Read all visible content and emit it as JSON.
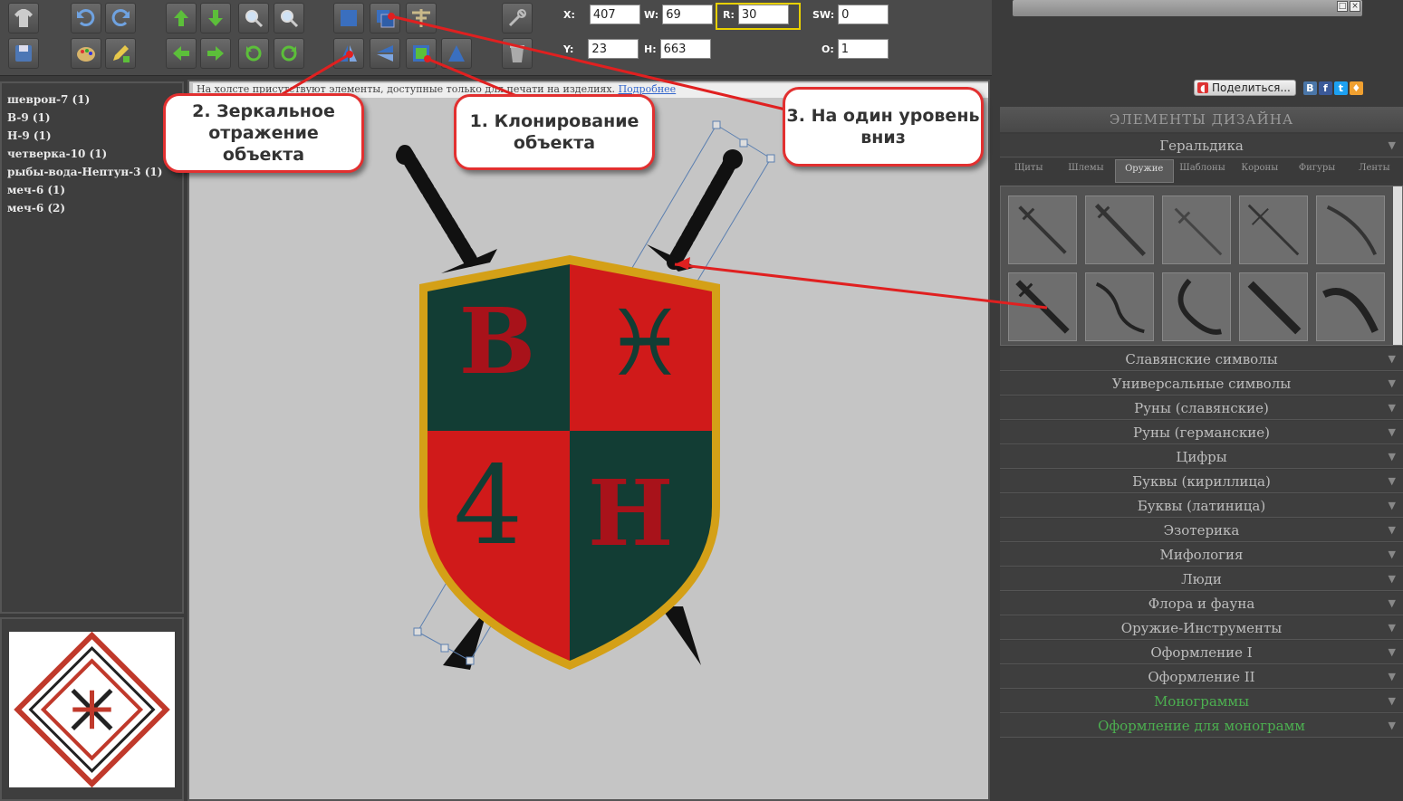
{
  "toolbar": {
    "fields": {
      "x": {
        "label": "X:",
        "value": "407"
      },
      "w": {
        "label": "W:",
        "value": "69"
      },
      "r": {
        "label": "R:",
        "value": "30"
      },
      "sw": {
        "label": "SW:",
        "value": "0"
      },
      "y": {
        "label": "Y:",
        "value": "23"
      },
      "h": {
        "label": "H:",
        "value": "663"
      },
      "o": {
        "label": "O:",
        "value": "1"
      }
    }
  },
  "layers": [
    "шеврон-7 (1)",
    "B-9 (1)",
    "H-9 (1)",
    "четверка-10 (1)",
    "рыбы-вода-Нептун-3 (1)",
    "меч-6 (1)",
    "меч-6 (2)"
  ],
  "infobar": {
    "text": "На холсте присутствуют элементы, доступные только для печати на изделиях.",
    "link": "Подробнее"
  },
  "callouts": {
    "mirror": "2. Зеркальное отражение объекта",
    "clone": "1. Клонирование объекта",
    "down": "3. На один уровень вниз"
  },
  "shield": {
    "letter_tl": "B",
    "letter_br": "H",
    "digit": "4",
    "glyph_tr": "♓"
  },
  "share": {
    "label": "Поделиться...",
    "icons": [
      "В",
      "f",
      "t",
      "♦"
    ]
  },
  "elements": {
    "header": "ЭЛЕМЕНТЫ ДИЗАЙНА",
    "open_category": "Геральдика",
    "tabs": [
      "Щиты",
      "Шлемы",
      "Оружие",
      "Шаблоны",
      "Короны",
      "Фигуры",
      "Ленты"
    ],
    "active_tab": "Оружие",
    "categories": [
      "Славянские символы",
      "Универсальные символы",
      "Руны (славянские)",
      "Руны (германские)",
      "Цифры",
      "Буквы (кириллица)",
      "Буквы (латиница)",
      "Эзотерика",
      "Мифология",
      "Люди",
      "Флора и фауна",
      "Оружие-Инструменты",
      "Оформление I",
      "Оформление II",
      "Монограммы",
      "Оформление для монограмм"
    ]
  },
  "colors": {
    "shield_red": "#d01a1a",
    "shield_green": "#123d34",
    "shield_rim": "#d4a017",
    "letter_red": "#a8121a",
    "callout_border": "#e23030",
    "highlight": "#e8d000"
  }
}
